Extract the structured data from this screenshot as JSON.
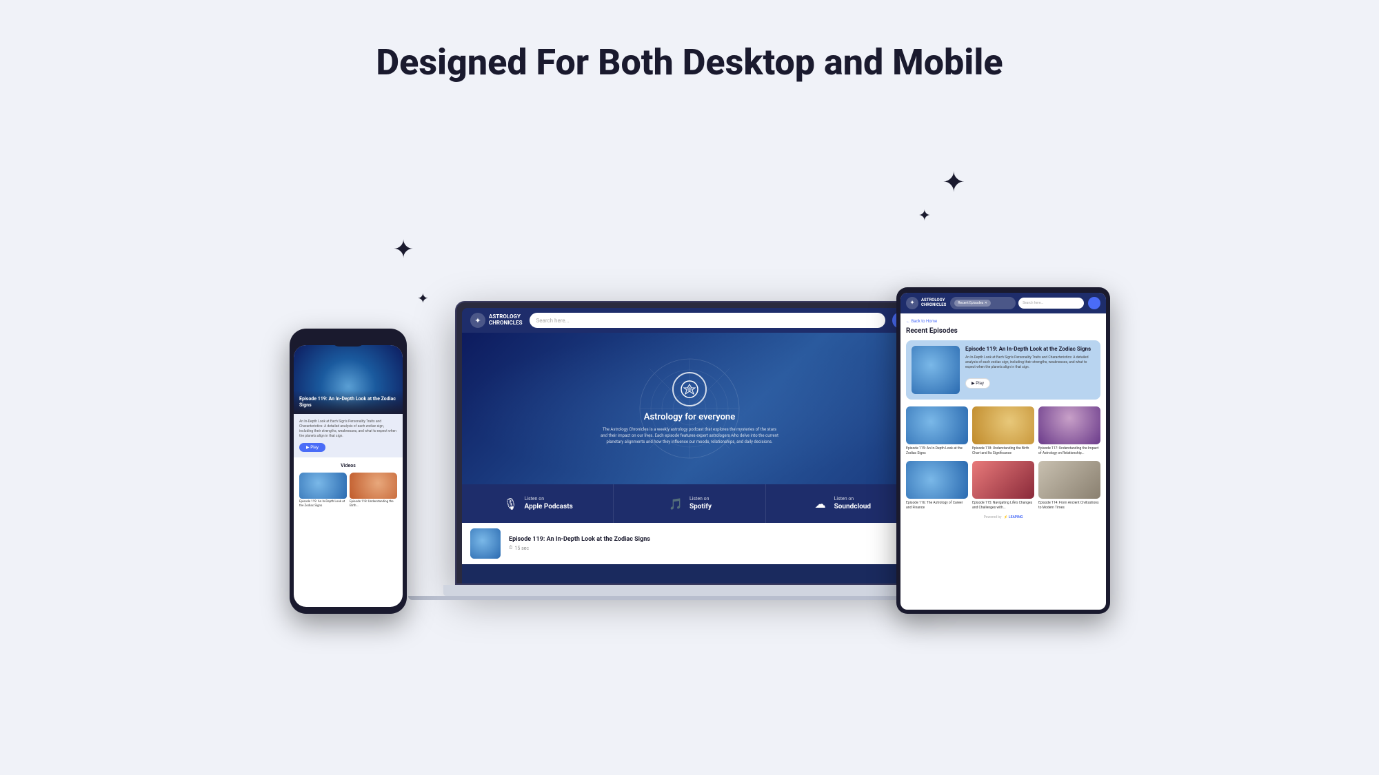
{
  "page": {
    "title": "Designed For Both Desktop and Mobile",
    "background_color": "#f0f2f8"
  },
  "app": {
    "name": "ASTROLOGY CHRONICLES",
    "logo_symbol": "✦",
    "tagline": "Astrology for everyone",
    "description": "The Astrology Chronicles is a weekly astrology podcast that explores the mysteries of the stars and their impact on our lives. Each episode features expert astrologers who delve into the current planetary alignments and how they influence our moods, relationships, and daily decisions.",
    "search_placeholder": "Search here..."
  },
  "platforms": [
    {
      "name": "Apple Podcasts",
      "label": "Listen on",
      "strong": "Apple Podcasts",
      "icon": "🎙"
    },
    {
      "name": "Spotify",
      "label": "Listen on",
      "strong": "Spotify",
      "icon": "🎵"
    },
    {
      "name": "Soundcloud",
      "label": "Listen on",
      "strong": "Soundcloud",
      "icon": "☁"
    }
  ],
  "episodes": [
    {
      "number": "119",
      "title": "Episode 119: An In-Depth Look at the Zodiac Signs",
      "short_title": "Episode 119: An In-Depth Look at the Zodiac Signs",
      "description": "An In-Depth Look at Each Sign's Personality Traits and Characteristics: A detailed analysis of each zodiac sign, including their strengths, weaknesses, and what to expect when the planets align in that sign.",
      "duration": "15 sec"
    },
    {
      "number": "118",
      "title": "Episode 118: Understanding the Birth Chart and Its Significance",
      "short_title": "Episode 118: Understanding the Birth..."
    },
    {
      "number": "117",
      "title": "Episode 117: Understanding the Impact of Astrology on Relationship...",
      "short_title": "Episode 117: Understanding the Impact of Astrology on Relationship..."
    },
    {
      "number": "116",
      "title": "Episode 116: The Astrology of Career and Finance",
      "short_title": "Episode 116: The Astrology of Career and Finance"
    },
    {
      "number": "115",
      "title": "Episode 115: Navigating Life's Changes and Challenges with...",
      "short_title": "Episode 115: Navigating Life's Changes and Challenges with..."
    },
    {
      "number": "114",
      "title": "Episode 114: From Ancient Civilizations to Modern Times",
      "short_title": "Episode 114: From Ancient Civilizations to Modern Times"
    }
  ],
  "nav": {
    "back_label": "← Back to Home",
    "section_title": "Recent Episodes",
    "recent_tag": "Recent Episodes ✕"
  },
  "powered_by": "Powered by",
  "powered_brand": "⚡ LEAPING"
}
